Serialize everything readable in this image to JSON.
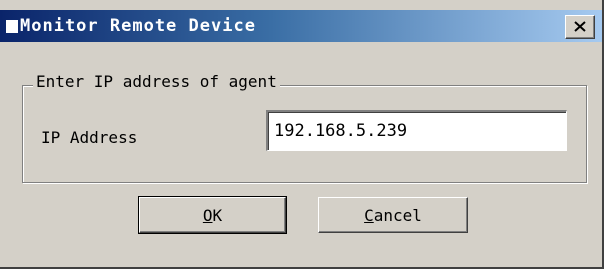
{
  "window": {
    "title": "Monitor Remote Device"
  },
  "titlebar": {
    "close_icon": "close-icon"
  },
  "group": {
    "label": "Enter IP address of agent"
  },
  "ip_field": {
    "label": "IP Address",
    "value": "192.168.5.239"
  },
  "buttons": {
    "ok": {
      "mnemonic": "O",
      "rest": "K"
    },
    "cancel": {
      "mnemonic": "C",
      "rest": "ancel"
    }
  }
}
